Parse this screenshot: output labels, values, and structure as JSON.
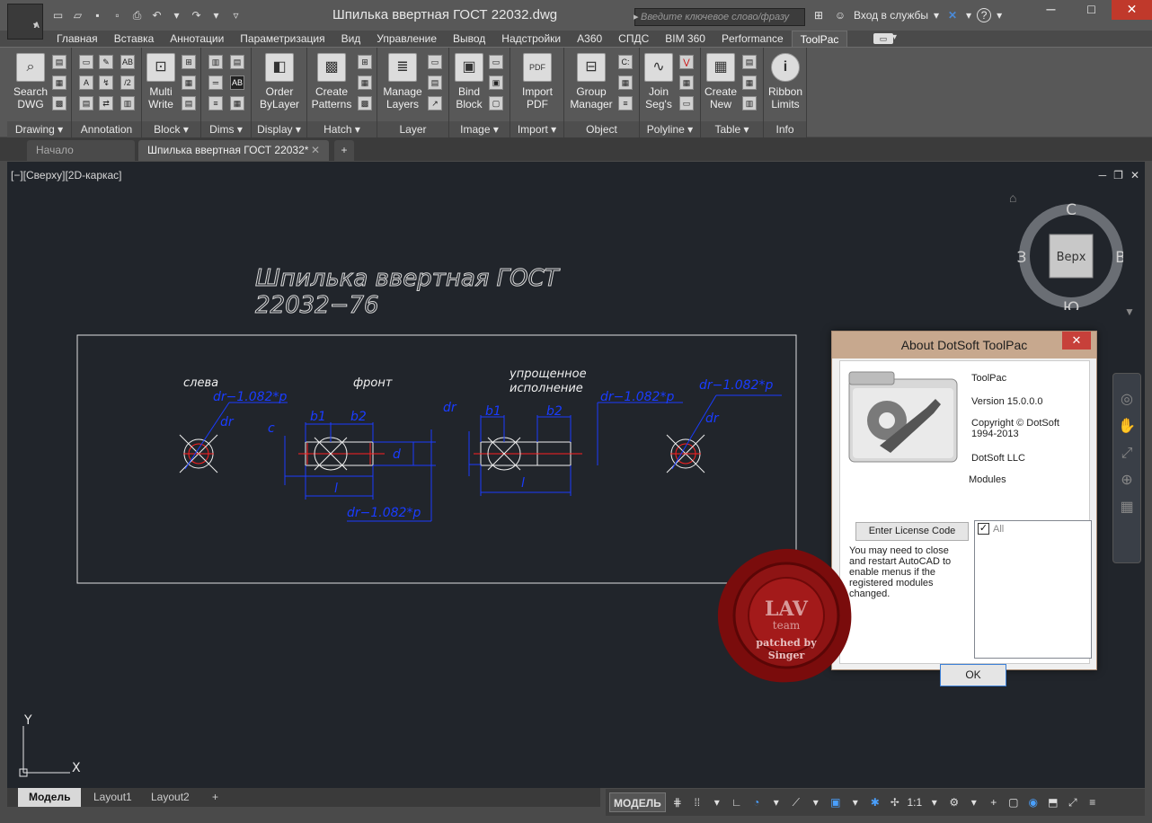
{
  "app": {
    "logo_letter": "A",
    "document_title": "Шпилька ввертная ГОСТ 22032.dwg"
  },
  "search": {
    "placeholder": "Введите ключевое слово/фразу"
  },
  "titlebar": {
    "signin_label": "Вход в службы",
    "help": "?"
  },
  "ribbon_tabs": [
    "Главная",
    "Вставка",
    "Аннотации",
    "Параметризация",
    "Вид",
    "Управление",
    "Вывод",
    "Надстройки",
    "A360",
    "СПДС",
    "BIM 360",
    "Performance",
    "ToolPac"
  ],
  "active_tab": "ToolPac",
  "panels": {
    "drawing": {
      "footer": "Drawing",
      "big": "Search DWG"
    },
    "annotation": {
      "footer": "Annotation"
    },
    "block": {
      "footer": "Block",
      "big": "Multi Write"
    },
    "dims": {
      "footer": "Dims"
    },
    "display": {
      "footer": "Display",
      "big": "Order ByLayer"
    },
    "hatch": {
      "footer": "Hatch",
      "big": "Create Patterns"
    },
    "layer": {
      "footer": "Layer",
      "big": "Manage Layers"
    },
    "image": {
      "footer": "Image",
      "big": "Bind Block"
    },
    "import": {
      "footer": "Import",
      "big": "Import PDF"
    },
    "object": {
      "footer": "Object",
      "big": "Group Manager"
    },
    "polyline": {
      "footer": "Polyline",
      "big": "Join Seg's"
    },
    "table": {
      "footer": "Table",
      "big": "Create New"
    },
    "info": {
      "footer": "Info",
      "big": "Ribbon Limits"
    }
  },
  "file_tabs": {
    "start": "Начало",
    "current": "Шпилька ввертная ГОСТ 22032*"
  },
  "viewport": {
    "label": "[−][Сверху][2D-каркас]"
  },
  "drawing_text": {
    "title_line1": "Шпилька ввертная ГОСТ",
    "title_line2": "22032−76",
    "left_view": "слева",
    "front_view": "фронт",
    "simplified_1": "упрощенное",
    "simplified_2": "исполнение",
    "dim_thread": "dr−1.082*p",
    "dim_dr": "dr",
    "dim_b1": "b1",
    "dim_b2": "b2",
    "dim_c": "c",
    "dim_l": "l",
    "dim_d": "d"
  },
  "viewcube": {
    "north": "С",
    "south": "Ю",
    "west": "З",
    "east": "В",
    "face": "Верх"
  },
  "ucs": {
    "x": "X",
    "y": "Y"
  },
  "model_tabs": [
    "Модель",
    "Layout1",
    "Layout2"
  ],
  "status": {
    "model": "МОДЕЛЬ",
    "scale": "1:1"
  },
  "about": {
    "title": "About DotSoft ToolPac",
    "product": "ToolPac",
    "version": "Version 15.0.0.0",
    "copyright_1": "Copyright © DotSoft",
    "copyright_2": "1994-2013",
    "company": "DotSoft LLC",
    "modules_label": "Modules",
    "module_all": "All",
    "license_button": "Enter License Code",
    "note": "You may need to close and restart AutoCAD to enable menus if the registered modules changed.",
    "ok": "OK"
  },
  "seal": {
    "line1": "LAV",
    "line2": "team",
    "line3": "patched by",
    "line4": "Singer"
  },
  "colors": {
    "canvas": "#21252b",
    "dim_blue": "#1a3cff",
    "red": "#ff2020",
    "seal": "#8b1010"
  }
}
